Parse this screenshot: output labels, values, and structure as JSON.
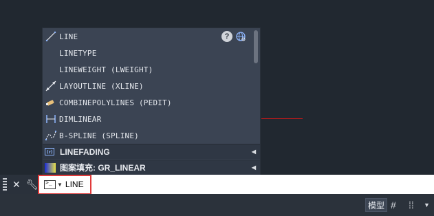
{
  "popup": {
    "items": [
      {
        "label": "LINE",
        "icon": "line-icon"
      },
      {
        "label": "LINETYPE",
        "icon": ""
      },
      {
        "label": "LINEWEIGHT (LWEIGHT)",
        "icon": ""
      },
      {
        "label": "LAYOUTLINE (XLINE)",
        "icon": "xline-icon"
      },
      {
        "label": "COMBINEPOLYLINES (PEDIT)",
        "icon": "pedit-icon"
      },
      {
        "label": "DIMLINEAR",
        "icon": "dimlinear-icon"
      },
      {
        "label": "B-SPLINE (SPLINE)",
        "icon": "spline-icon"
      }
    ],
    "help_icon": "help-icon",
    "web_icon": "globe-search-icon",
    "groups": [
      {
        "label": "LINEFADING"
      },
      {
        "label": "图案填充: GR_LINEAR"
      }
    ]
  },
  "command_line": {
    "value": "LINE"
  },
  "status_bar": {
    "model_label": "模型"
  },
  "colors": {
    "canvas_bg": "#212830",
    "popup_bg": "#3b4453",
    "red_highlight": "#e03a3a",
    "accent_line": "#c21a1a"
  }
}
